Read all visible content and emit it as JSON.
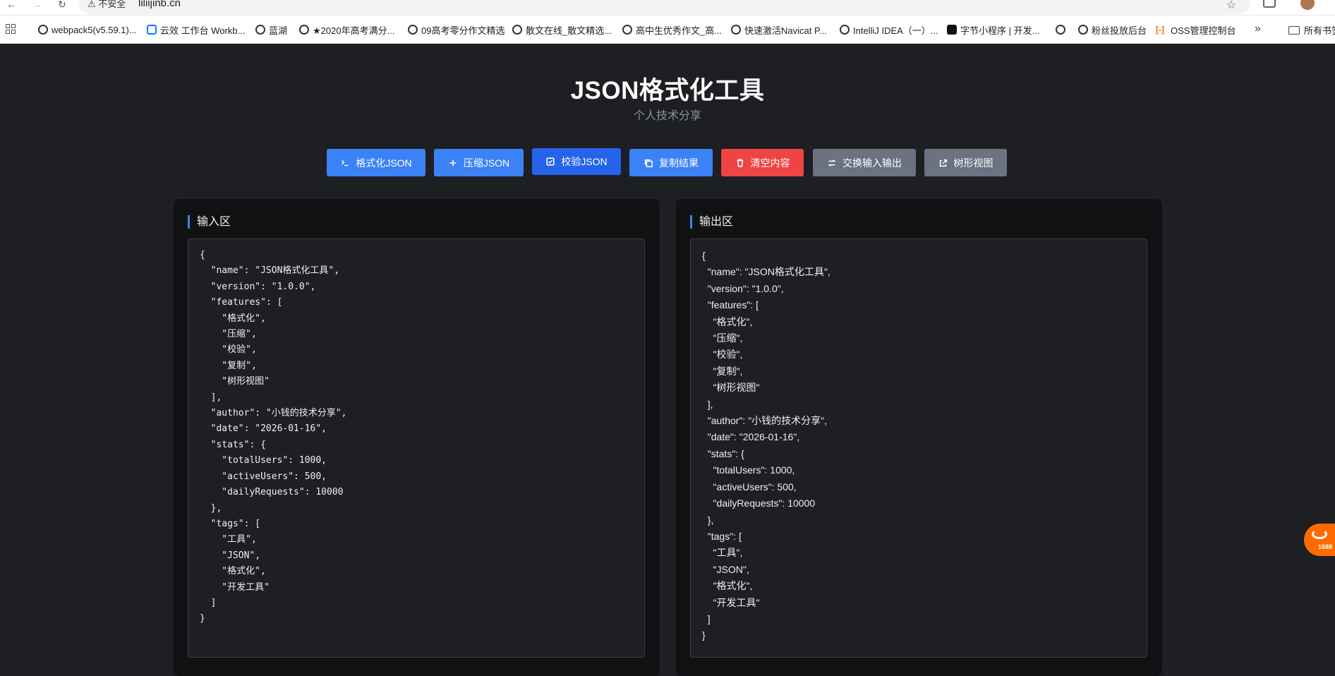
{
  "browser": {
    "security_label": "不安全",
    "url": "liliijinb.cn",
    "bookmarks": [
      "webpack5(v5.59.1)...",
      "云效 工作台 Workb...",
      "蓝湖",
      "★2020年高考满分...",
      "09高考零分作文精选",
      "散文在线_散文精选...",
      "高中生优秀作文_高...",
      "快速激活Navicat P...",
      "IntelliJ IDEA（一）...",
      "字节小程序 | 开发...",
      "",
      "粉丝投放后台",
      "OSS管理控制台"
    ],
    "bookmarks_folder": "所有书签"
  },
  "header": {
    "title": "JSON格式化工具",
    "subtitle": "个人技术分享"
  },
  "toolbar": {
    "format": "格式化JSON",
    "compress": "压缩JSON",
    "validate": "校验JSON",
    "copy": "复制结果",
    "clear": "清空内容",
    "swap": "交换输入输出",
    "tree": "树形视图"
  },
  "input_panel": {
    "heading": "输入区",
    "content": "{\n  \"name\": \"JSON格式化工具\",\n  \"version\": \"1.0.0\",\n  \"features\": [\n    \"格式化\",\n    \"压缩\",\n    \"校验\",\n    \"复制\",\n    \"树形视图\"\n  ],\n  \"author\": \"小钱的技术分享\",\n  \"date\": \"2026-01-16\",\n  \"stats\": {\n    \"totalUsers\": 1000,\n    \"activeUsers\": 500,\n    \"dailyRequests\": 10000\n  },\n  \"tags\": [\n    \"工具\",\n    \"JSON\",\n    \"格式化\",\n    \"开发工具\"\n  ]\n}"
  },
  "output_panel": {
    "heading": "输出区",
    "content": "{\n  \"name\": \"JSON格式化工具\",\n  \"version\": \"1.0.0\",\n  \"features\": [\n    \"格式化\",\n    \"压缩\",\n    \"校验\",\n    \"复制\",\n    \"树形视图\"\n  ],\n  \"author\": \"小钱的技术分享\",\n  \"date\": \"2026-01-16\",\n  \"stats\": {\n    \"totalUsers\": 1000,\n    \"activeUsers\": 500,\n    \"dailyRequests\": 10000\n  },\n  \"tags\": [\n    \"工具\",\n    \"JSON\",\n    \"格式化\",\n    \"开发工具\"\n  ]\n}"
  },
  "float_widget": {
    "label": "1688"
  },
  "colors": {
    "page_bg": "#1d1f23",
    "panel_bg": "#101113",
    "primary": "#3b82f6",
    "primary_active": "#2563eb",
    "danger": "#ef4444",
    "secondary": "#6b7280"
  }
}
